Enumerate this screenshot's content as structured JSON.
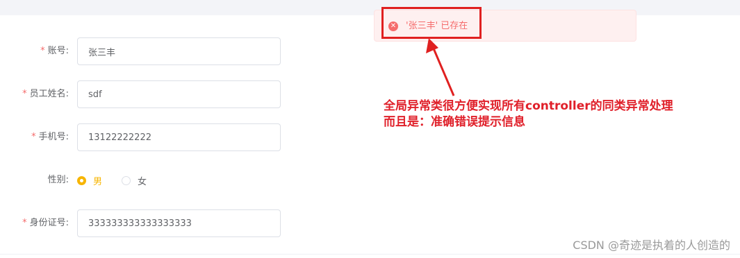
{
  "form": {
    "account": {
      "label": "账号:",
      "required": "*",
      "value": "张三丰"
    },
    "employee_name": {
      "label": "员工姓名:",
      "required": "*",
      "value": "sdf"
    },
    "phone": {
      "label": "手机号:",
      "required": "*",
      "value": "13122222222"
    },
    "gender": {
      "label": "性别:",
      "options": [
        {
          "label": "男",
          "selected": true
        },
        {
          "label": "女",
          "selected": false
        }
      ]
    },
    "id_card": {
      "label": "身份证号:",
      "required": "*",
      "value": "333333333333333333"
    }
  },
  "toast": {
    "type": "error",
    "icon": "error-circle-icon",
    "icon_glyph": "✕",
    "message": "'张三丰' 已存在"
  },
  "annotation": {
    "line1": "全局异常类很方便实现所有controller的同类异常处理",
    "line2": "而且是：准确错误提示信息",
    "color": "#e0202a"
  },
  "watermark": "CSDN @奇迹是执着的人创造的",
  "colors": {
    "accent": "#f7b500",
    "error": "#f56c6c",
    "annotation_red": "#e02020"
  }
}
